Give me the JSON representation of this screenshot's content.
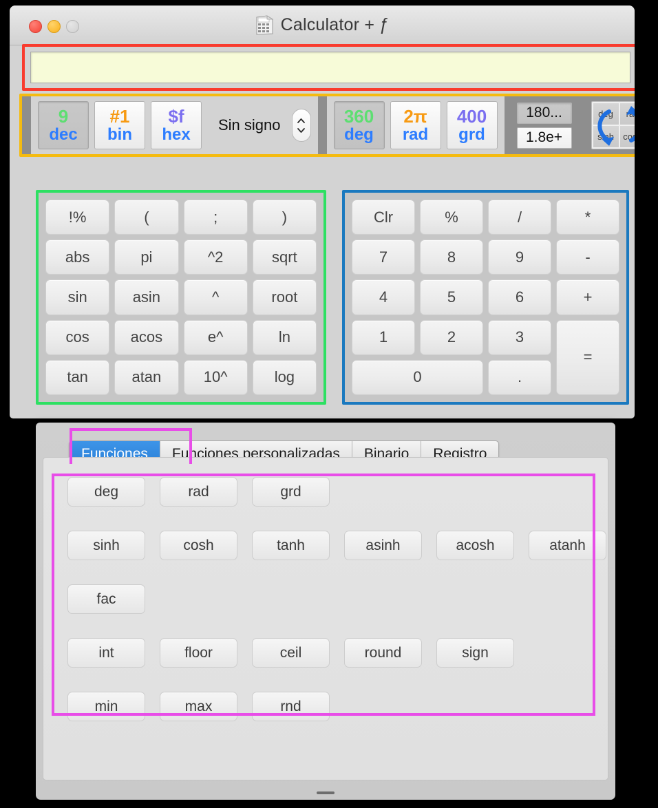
{
  "window": {
    "title": "Calculator + ƒ",
    "icon": "calculator-icon",
    "traffic_lights": [
      "close",
      "minimize",
      "zoom"
    ]
  },
  "display": {
    "value": "",
    "bg_color": "#f7fbd8",
    "annotation_color": "#f93b2e"
  },
  "toolbar": {
    "annotation_color": "#f5bb10",
    "base_modes": [
      {
        "top": "9",
        "bottom": "dec",
        "top_color": "#5ede72",
        "selected": true
      },
      {
        "top": "#1",
        "bottom": "bin",
        "top_color": "#f79a12",
        "selected": false
      },
      {
        "top": "$f",
        "bottom": "hex",
        "top_color": "#7b6ff0",
        "selected": false
      }
    ],
    "sign_label": "Sin signo",
    "stepper": "up-down-stepper",
    "angle_modes": [
      {
        "top": "360",
        "bottom": "deg",
        "top_color": "#5ede72",
        "selected": true
      },
      {
        "top": "2π",
        "bottom": "rad",
        "top_color": "#f79a12",
        "selected": false
      },
      {
        "top": "400",
        "bottom": "grd",
        "top_color": "#7b6ff0",
        "selected": false
      }
    ],
    "precision": [
      {
        "label": "180...",
        "selected": true
      },
      {
        "label": "1.8e+",
        "selected": false
      }
    ],
    "quad": {
      "cells": [
        "deg",
        "rad",
        "sinh",
        "cosh"
      ],
      "arrow_color": "#1f6fe0"
    }
  },
  "keypad_functions": {
    "annotation_color": "#2de062",
    "keys": [
      "!%",
      "(",
      ";",
      ")",
      "abs",
      "pi",
      "^2",
      "sqrt",
      "sin",
      "asin",
      "^",
      "root",
      "cos",
      "acos",
      "e^",
      "ln",
      "tan",
      "atan",
      "10^",
      "log"
    ]
  },
  "keypad_numeric": {
    "annotation_color": "#1a79bf",
    "keys": [
      {
        "label": "Clr"
      },
      {
        "label": "%"
      },
      {
        "label": "/"
      },
      {
        "label": "*"
      },
      {
        "label": "7"
      },
      {
        "label": "8"
      },
      {
        "label": "9"
      },
      {
        "label": "-"
      },
      {
        "label": "4"
      },
      {
        "label": "5"
      },
      {
        "label": "6"
      },
      {
        "label": "+"
      },
      {
        "label": "1"
      },
      {
        "label": "2"
      },
      {
        "label": "3"
      },
      {
        "label": "=",
        "span_rows": 2
      },
      {
        "label": "0",
        "span_cols": 2
      },
      {
        "label": "."
      }
    ]
  },
  "panel": {
    "annotation_color": "#e84de8",
    "tabs": [
      {
        "label": "Funciones",
        "active": true
      },
      {
        "label": "Funciones personalizadas",
        "active": false
      },
      {
        "label": "Binario",
        "active": false
      },
      {
        "label": "Registro",
        "active": false
      }
    ],
    "function_rows": [
      [
        "deg",
        "rad",
        "grd"
      ],
      [
        "sinh",
        "cosh",
        "tanh",
        "asinh",
        "acosh",
        "atanh"
      ],
      [
        "fac"
      ],
      [
        "int",
        "floor",
        "ceil",
        "round",
        "sign"
      ],
      [
        "min",
        "max",
        "rnd"
      ]
    ]
  }
}
